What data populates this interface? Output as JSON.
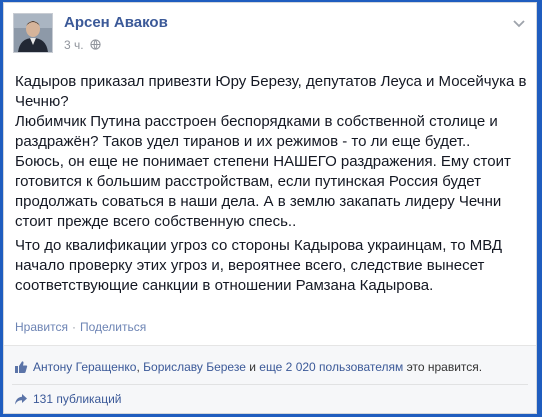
{
  "post": {
    "author": "Арсен Аваков",
    "time": "3 ч.",
    "paragraphs": [
      "Кадыров приказал привезти Юру Березу, депутатов Леуса и Мосейчука в Чечню?\nЛюбимчик Путина расстроен беспорядками в собственной столице и раздражён? Таков удел тиранов и их режимов - то ли еще будет..\nБоюсь, он еще не понимает степени НАШЕГО раздражения. Ему стоит готовится к большим расстройствам, если путинская Россия будет продолжать соваться в наши дела. А в землю закапать лидеру Чечни стоит прежде всего собственную спесь..",
      "Что до квалификации угроз со стороны Кадырова украинцам, то МВД начало проверку этих угроз и, вероятнее всего, следствие вынесет соответствующие санкции в отношении Рамзана Кадырова."
    ]
  },
  "actions": {
    "like": "Нравится",
    "separator": "·",
    "share": "Поделиться"
  },
  "likes": {
    "name1": "Антону Геращенко",
    "comma": ",",
    "name2": "Бориславу Березе",
    "and": "и",
    "others": "еще 2 020 пользователям",
    "suffix": "это нравится."
  },
  "shares": {
    "label": "131 публикаций"
  },
  "icons": {
    "globe": "globe-icon",
    "chevron": "chevron-down-icon",
    "thumb": "thumbs-up-icon",
    "share": "share-icon"
  },
  "colors": {
    "background": "#1f5dbf",
    "link": "#3b5998",
    "muted": "#90949c"
  }
}
